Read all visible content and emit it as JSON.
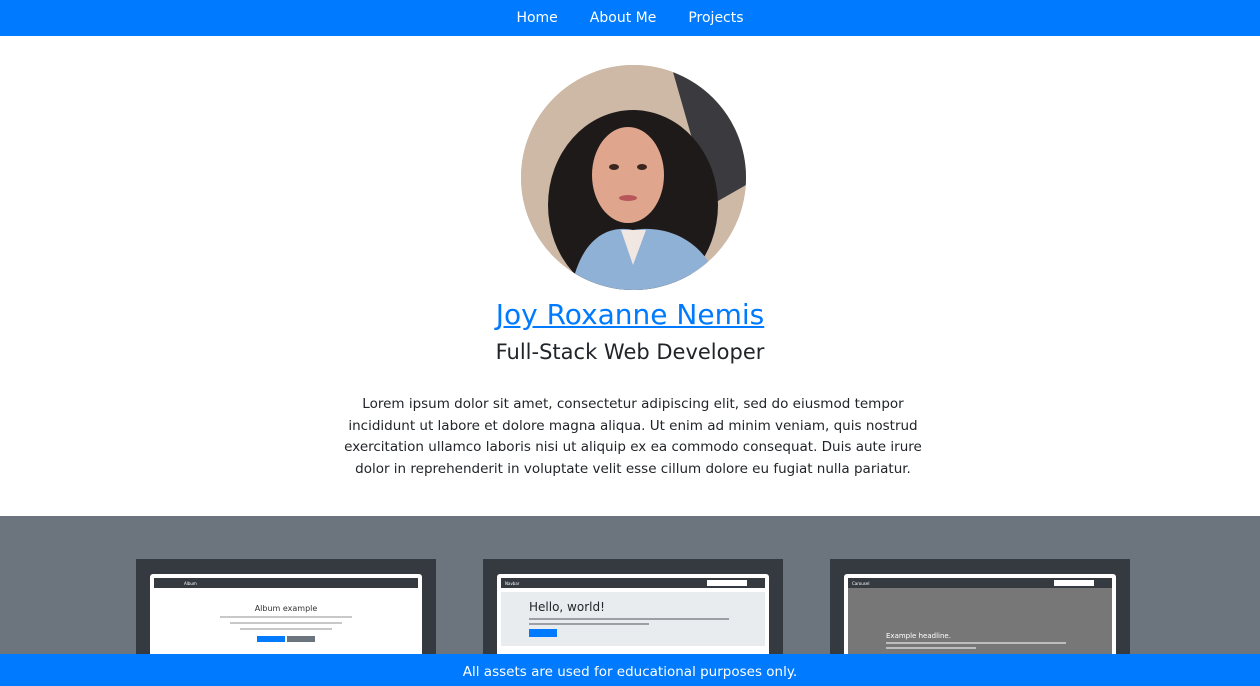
{
  "nav": {
    "items": [
      {
        "label": "Home"
      },
      {
        "label": "About Me"
      },
      {
        "label": "Projects"
      }
    ]
  },
  "profile": {
    "name": "Joy Roxanne Nemis",
    "role": "Full-Stack Web Developer",
    "bio": "Lorem ipsum dolor sit amet, consectetur adipiscing elit, sed do eiusmod tempor incididunt ut labore et dolore magna aliqua. Ut enim ad minim veniam, quis nostrud exercitation ullamco laboris nisi ut aliquip ex ea commodo consequat. Duis aute irure dolor in reprehenderit in voluptate velit esse cillum dolore eu fugiat nulla pariatur."
  },
  "projects": [
    {
      "heading": "Album example",
      "brand": "Album"
    },
    {
      "heading": "Hello, world!",
      "brand": "Navbar"
    },
    {
      "heading": "Example headline.",
      "brand": "Carousel"
    }
  ],
  "footer": {
    "text": "All assets are used for educational purposes only."
  },
  "colors": {
    "primary": "#007bff",
    "section_gray": "#6c757d",
    "card_dark": "#343a40"
  }
}
